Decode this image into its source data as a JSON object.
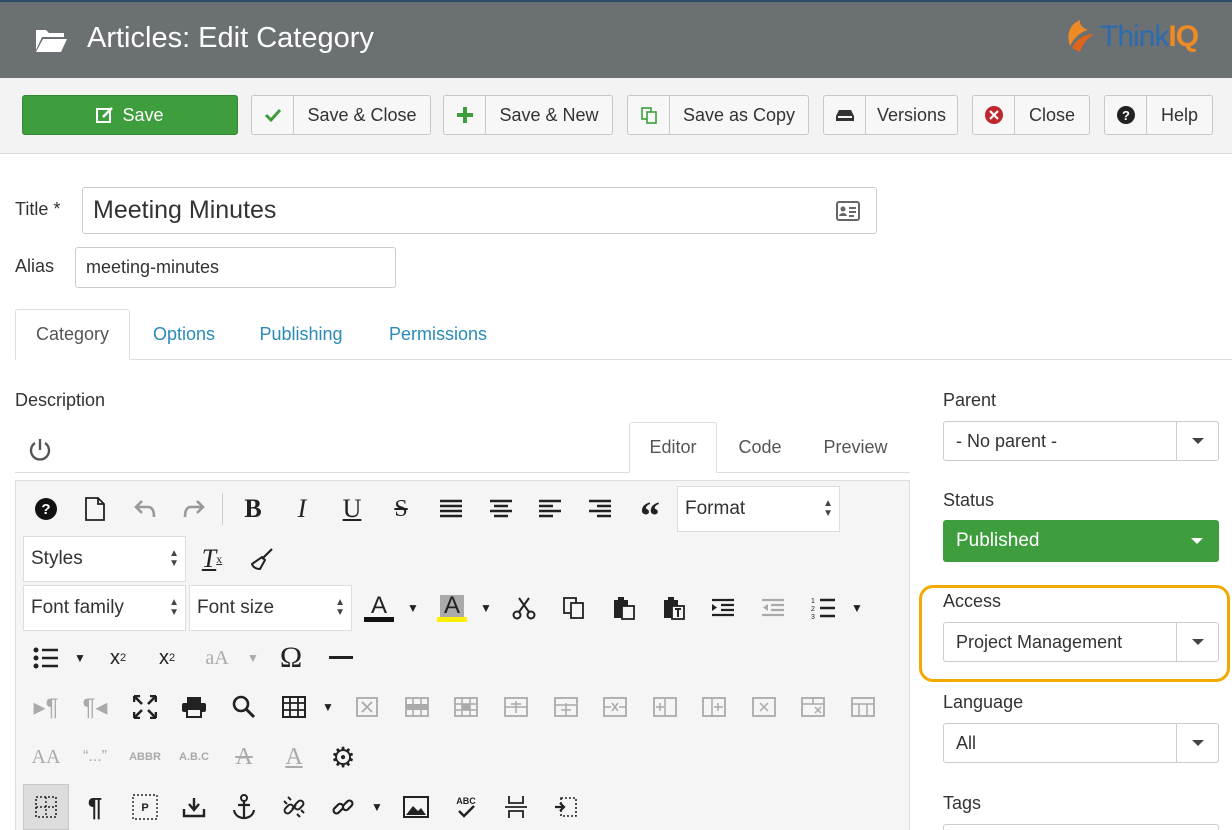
{
  "header": {
    "title": "Articles: Edit Category",
    "logo_text_1": "Think",
    "logo_text_2": "IQ"
  },
  "toolbar": {
    "save": "Save",
    "save_close": "Save & Close",
    "save_new": "Save & New",
    "save_copy": "Save as Copy",
    "versions": "Versions",
    "close": "Close",
    "help": "Help"
  },
  "form": {
    "title_label": "Title *",
    "title_value": "Meeting Minutes",
    "alias_label": "Alias",
    "alias_value": "meeting-minutes"
  },
  "tabs": [
    "Category",
    "Options",
    "Publishing",
    "Permissions"
  ],
  "description_label": "Description",
  "editor": {
    "tabs": [
      "Editor",
      "Code",
      "Preview"
    ],
    "format_select": "Format",
    "styles_select": "Styles",
    "font_family_select": "Font family",
    "font_size_select": "Font size"
  },
  "sidebar": {
    "parent_label": "Parent",
    "parent_value": "- No parent -",
    "status_label": "Status",
    "status_value": "Published",
    "access_label": "Access",
    "access_value": "Project Management",
    "language_label": "Language",
    "language_value": "All",
    "tags_label": "Tags"
  },
  "colors": {
    "header_bg": "#6b7073",
    "save_green": "#3e9e3e",
    "link_blue": "#2a8ab8",
    "highlight": "#f2a900"
  }
}
